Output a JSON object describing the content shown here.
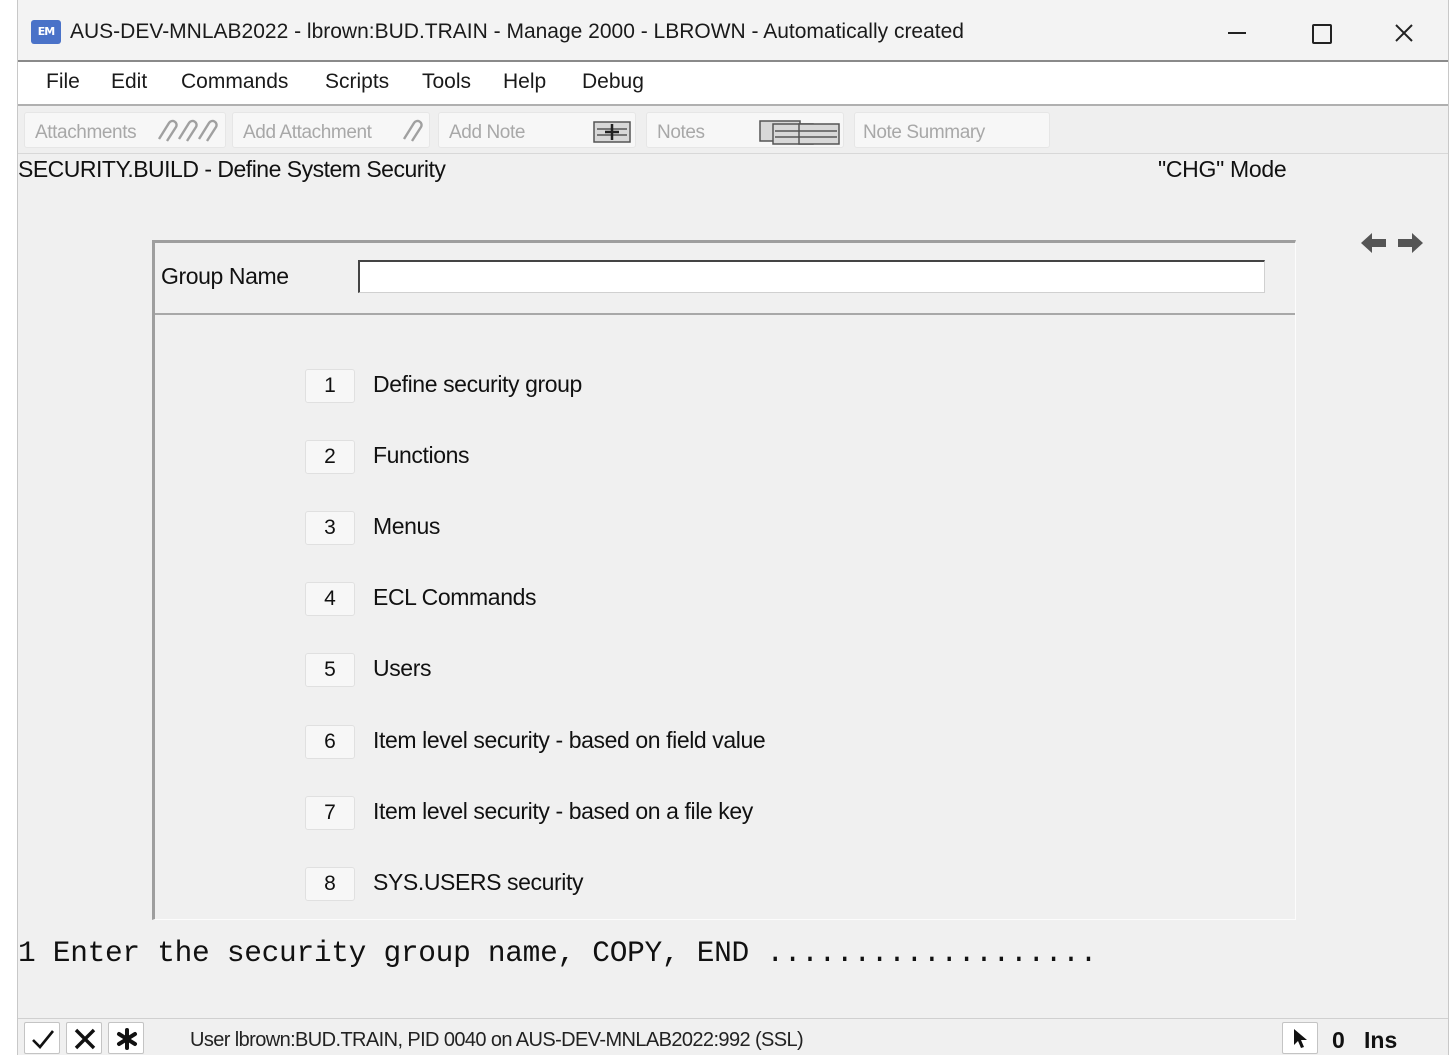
{
  "window": {
    "app_icon_text": "EM",
    "title": "AUS-DEV-MNLAB2022 - lbrown:BUD.TRAIN - Manage 2000 - LBROWN - Automatically created"
  },
  "menu": {
    "items": [
      "File",
      "Edit",
      "Commands",
      "Scripts",
      "Tools",
      "Help",
      "Debug"
    ]
  },
  "toolbar": {
    "attachments": "Attachments",
    "add_attachment": "Add Attachment",
    "add_note": "Add Note",
    "notes": "Notes",
    "note_summary": "Note Summary"
  },
  "header": {
    "program_title": "SECURITY.BUILD - Define System Security",
    "mode": "\"CHG\" Mode"
  },
  "form": {
    "group_name_label": "Group Name",
    "group_name_value": ""
  },
  "options": [
    {
      "num": "1",
      "label": "Define security group"
    },
    {
      "num": "2",
      "label": "Functions"
    },
    {
      "num": "3",
      "label": "Menus"
    },
    {
      "num": "4",
      "label": "ECL Commands"
    },
    {
      "num": "5",
      "label": "Users"
    },
    {
      "num": "6",
      "label": "Item level security - based on field value"
    },
    {
      "num": "7",
      "label": "Item level security - based on a file key"
    },
    {
      "num": "8",
      "label": "SYS.USERS security"
    }
  ],
  "prompt": {
    "text": "1 Enter the security group name, COPY, END ..................."
  },
  "status": {
    "text": "User lbrown:BUD.TRAIN, PID 0040 on AUS-DEV-MNLAB2022:992 (SSL)",
    "count": "0",
    "mode": "Ins"
  },
  "colors": {
    "window_bg": "#f0f0f0",
    "icon_blue": "#4a72c8",
    "disabled_text": "#a8a8a8"
  }
}
